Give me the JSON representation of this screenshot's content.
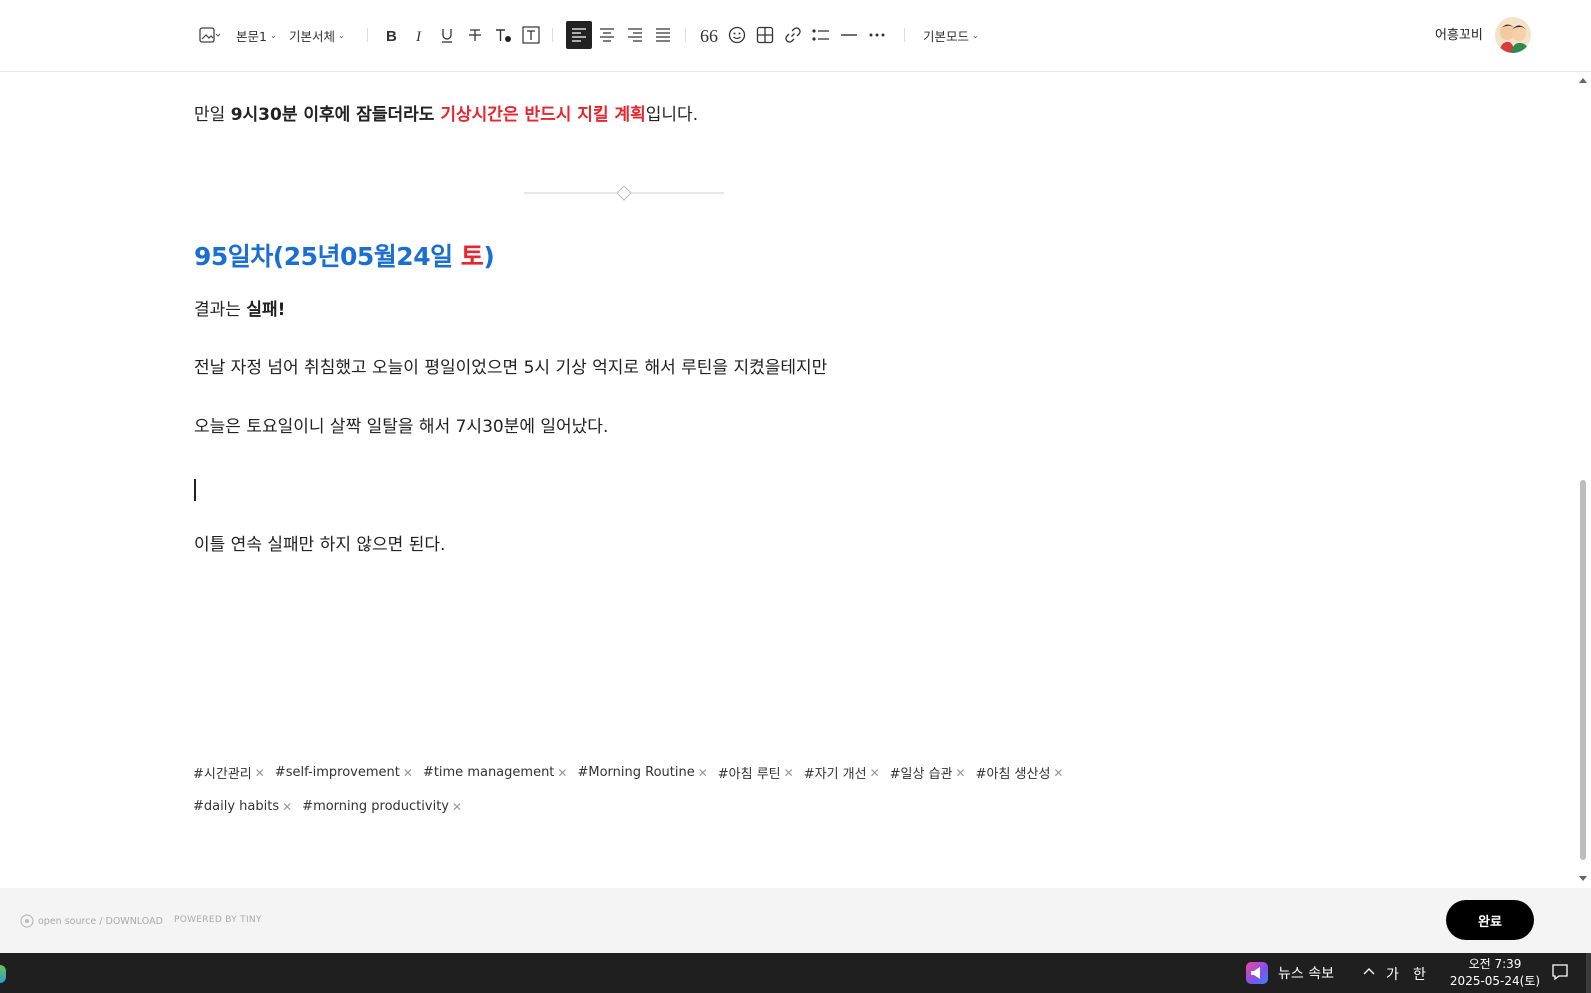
{
  "toolbar": {
    "style_select": "본문1",
    "font_select": "기본서체",
    "mode_select": "기본모드",
    "user_name": "어흥꼬비"
  },
  "content": {
    "line1": {
      "prefix": "만일 ",
      "bold": "9시30분 이후에 잠들더라도 ",
      "red": "기상시간은 반드시 지킬 계획",
      "suffix": "입니다."
    },
    "heading": {
      "blue": "95일차(25년05월24일 ",
      "red": "토",
      "end": ")"
    },
    "result": {
      "prefix": "결과는 ",
      "bold": "실패!"
    },
    "line2": "전날 자정 넘어 취침했고 오늘이 평일이었으면 5시 기상 억지로 해서 루틴을 지켰을테지만",
    "line3": "오늘은 토요일이니 살짝 일탈을 해서 7시30분에 일어났다.",
    "line4": "이틀 연속 실패만 하지 않으면 된다."
  },
  "tags_row1": [
    "#시간관리",
    "#self-improvement",
    "#time management",
    "#Morning Routine",
    "#아침 루틴",
    "#자기 개선",
    "#일상 습관",
    "#아침 생산성"
  ],
  "tags_row2": [
    "#daily habits",
    "#morning productivity"
  ],
  "footer": {
    "brand": "open source / DOWNLOAD",
    "powered": "POWERED BY TINY",
    "done_label": "완료"
  },
  "taskbar": {
    "news_label": "뉴스 속보",
    "ime_lang": "가",
    "ime_mode": "한",
    "time": "오전 7:39",
    "date": "2025-05-24(토)"
  },
  "colors": {
    "heading_blue": "#1a6fd1",
    "emphasis_red": "#e8252e",
    "done_button": "#000000"
  }
}
